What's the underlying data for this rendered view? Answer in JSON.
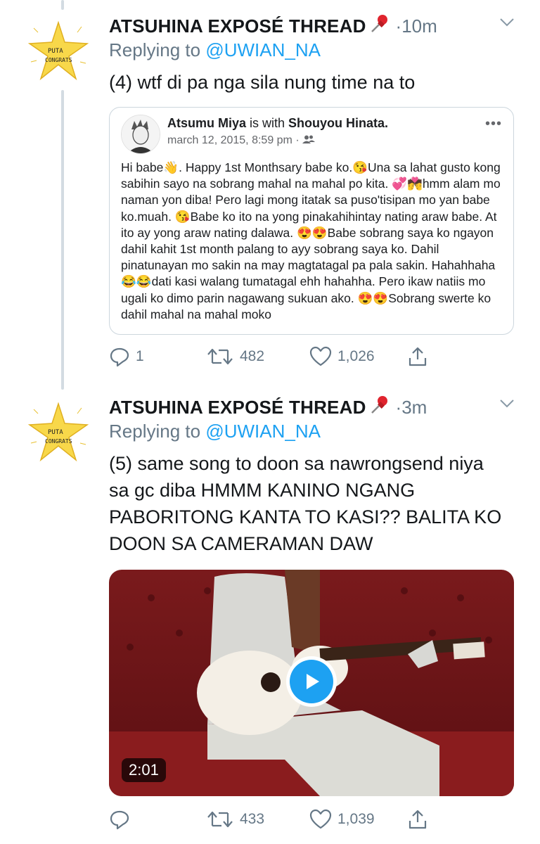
{
  "tweets": [
    {
      "author": "ATSUHINA EXPOSÉ THREAD",
      "meta": "·10m",
      "replying_prefix": "Replying to ",
      "replying_handle": "@UWIAN_NA",
      "text": "(4) wtf di pa nga sila nung time na to",
      "avatar_text_1": "PUTA",
      "avatar_text_2": "CONGRATS",
      "quote": {
        "author": "Atsumu Miya",
        "with_text": " is with ",
        "tagged": "Shouyou Hinata.",
        "date": "march 12, 2015, 8:59 pm · ",
        "body": "Hi babe👋. Happy 1st Monthsary babe ko.😘Una sa lahat gusto kong sabihin sayo na sobrang mahal na mahal po kita. 💞💏hmm alam mo naman yon diba! Pero lagi mong itatak sa puso'tisipan mo yan babe ko.muah. 😘Babe ko ito na yong pinakahihintay nating araw babe. At ito ay yong araw nating dalawa. 😍😍Babe sobrang saya ko ngayon dahil kahit 1st month palang to ayy sobrang saya ko. Dahil pinatunayan mo sakin na may magtatagal pa pala sakin. Hahahhaha 😂😂dati kasi walang tumatagal ehh hahahha. Pero ikaw natiis mo ugali ko dimo parin nagawang sukuan ako. 😍😍Sobrang swerte ko dahil mahal na mahal moko"
      },
      "replies": "1",
      "retweets": "482",
      "likes": "1,026"
    },
    {
      "author": "ATSUHINA EXPOSÉ THREAD",
      "meta": "·3m",
      "replying_prefix": "Replying to ",
      "replying_handle": "@UWIAN_NA",
      "text": "(5) same song to doon sa nawrongsend niya sa gc diba HMMM KANINO NGANG PABORITONG KANTA TO KASI?? BALITA KO DOON SA CAMERAMAN DAW",
      "avatar_text_1": "PUTA",
      "avatar_text_2": "CONGRATS",
      "video_duration": "2:01",
      "replies": "",
      "retweets": "433",
      "likes": "1,039"
    }
  ],
  "colors": {
    "accent": "#1da1f2",
    "muted": "#657786",
    "thread_line": "#d3dbe2"
  },
  "icons": [
    "reply-icon",
    "retweet-icon",
    "like-icon",
    "share-icon",
    "caret-down-icon",
    "pin-icon",
    "play-icon",
    "audience-friends-icon"
  ]
}
